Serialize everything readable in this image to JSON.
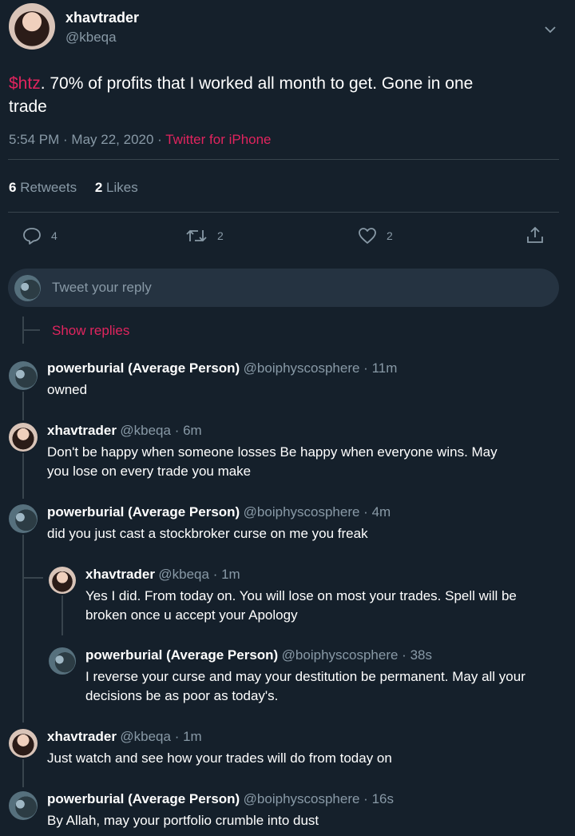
{
  "tweet": {
    "author_name": "xhavtrader",
    "author_handle": "@kbeqa",
    "cashtag": "$htz",
    "text_rest": ". 70% of profits that I worked all month to get.  Gone in one",
    "text_line2": "trade",
    "timestamp": "5:54 PM · May 22, 2020 · ",
    "source": "Twitter for iPhone",
    "retweets_count": "6",
    "retweets_label": "Retweets",
    "likes_count": "2",
    "likes_label": "Likes",
    "actions": {
      "reply_count": "4",
      "retweet_count": "2",
      "like_count": "2"
    }
  },
  "reply_box": {
    "placeholder": "Tweet your reply"
  },
  "show_replies": "Show replies",
  "replies": [
    {
      "name": "powerburial (Average Person)",
      "meta": "@boiphyscosphere · 11m",
      "lines": [
        "owned"
      ]
    },
    {
      "name": "xhavtrader",
      "meta": "@kbeqa · 6m",
      "lines": [
        "Don't be happy when someone losses   Be happy when everyone wins.  May",
        "you lose on every trade you make"
      ]
    },
    {
      "name": "powerburial (Average Person)",
      "meta": "@boiphyscosphere · 4m",
      "lines": [
        "did you just cast a stockbroker curse on me you freak"
      ]
    },
    {
      "name": "xhavtrader",
      "meta": "@kbeqa · 1m",
      "lines": [
        "Yes I did.  From today on.  You will lose on most your trades.  Spell will be",
        "broken once u accept your Apology"
      ]
    },
    {
      "name": "powerburial (Average Person)",
      "meta": "@boiphyscosphere · 38s",
      "lines": [
        "I reverse your curse and may your destitution be permanent. May all your",
        "decisions be as poor as today's."
      ]
    },
    {
      "name": "xhavtrader",
      "meta": "@kbeqa · 1m",
      "lines": [
        "Just watch and see how your trades will do from today on"
      ]
    },
    {
      "name": "powerburial (Average Person)",
      "meta": "@boiphyscosphere · 16s",
      "lines": [
        "By Allah, may your portfolio crumble into dust"
      ]
    }
  ],
  "icons": [
    "chevron-down-icon",
    "reply-icon",
    "retweet-icon",
    "heart-icon",
    "share-icon"
  ],
  "colors": {
    "background": "#15202b",
    "accent": "#e0245e",
    "muted": "#8899a6",
    "divider": "#38444d"
  }
}
